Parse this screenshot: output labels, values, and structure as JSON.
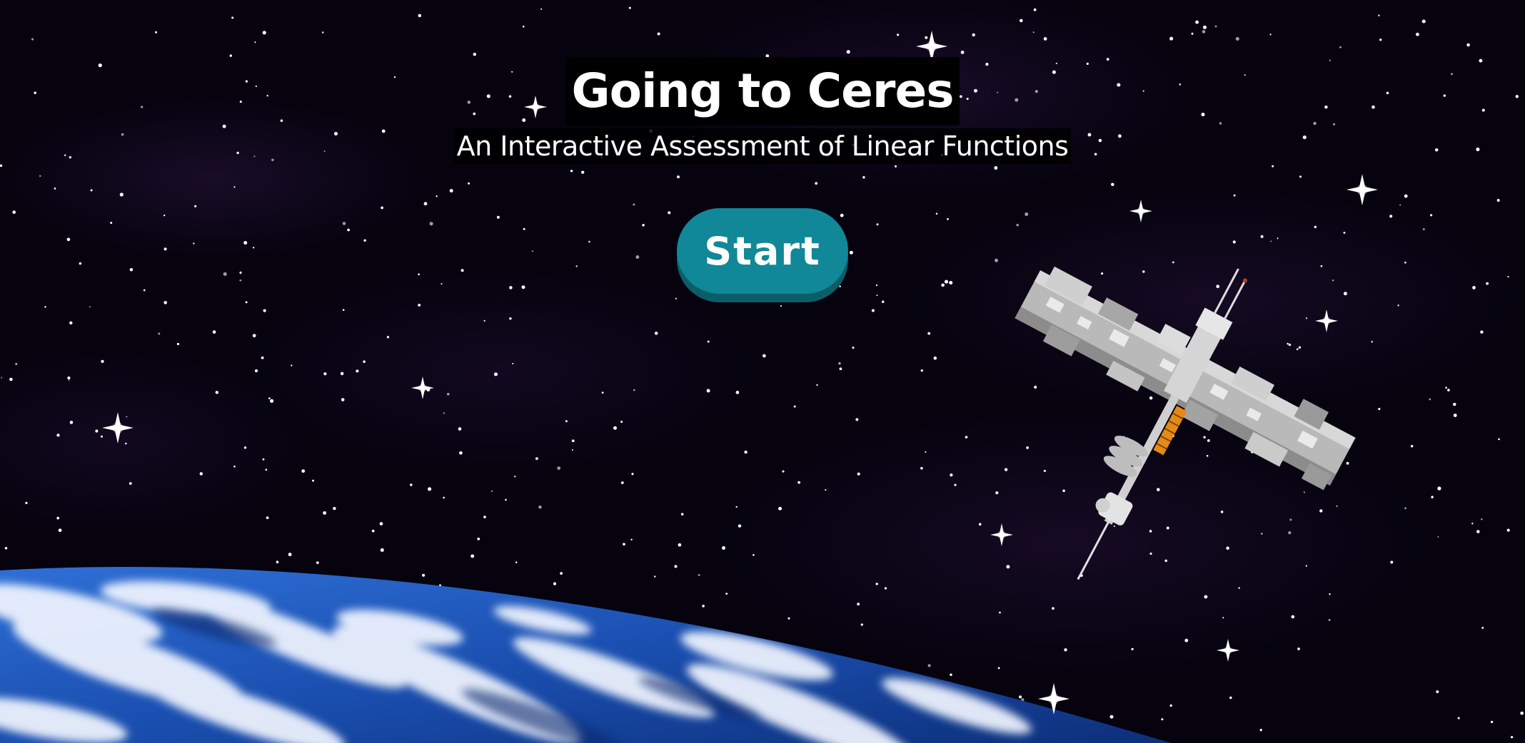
{
  "title": "Going to Ceres",
  "subtitle": "An Interactive Assessment of Linear Functions",
  "start_button": {
    "label": "Start"
  },
  "colors": {
    "background": "#06030f",
    "button": "#108897",
    "button_shadow": "#0b5e68",
    "text": "#ffffff",
    "earth_ocean": "#1a4fb0"
  },
  "icons": [
    "space-station-illustration",
    "earth-illustration",
    "starfield-background"
  ]
}
